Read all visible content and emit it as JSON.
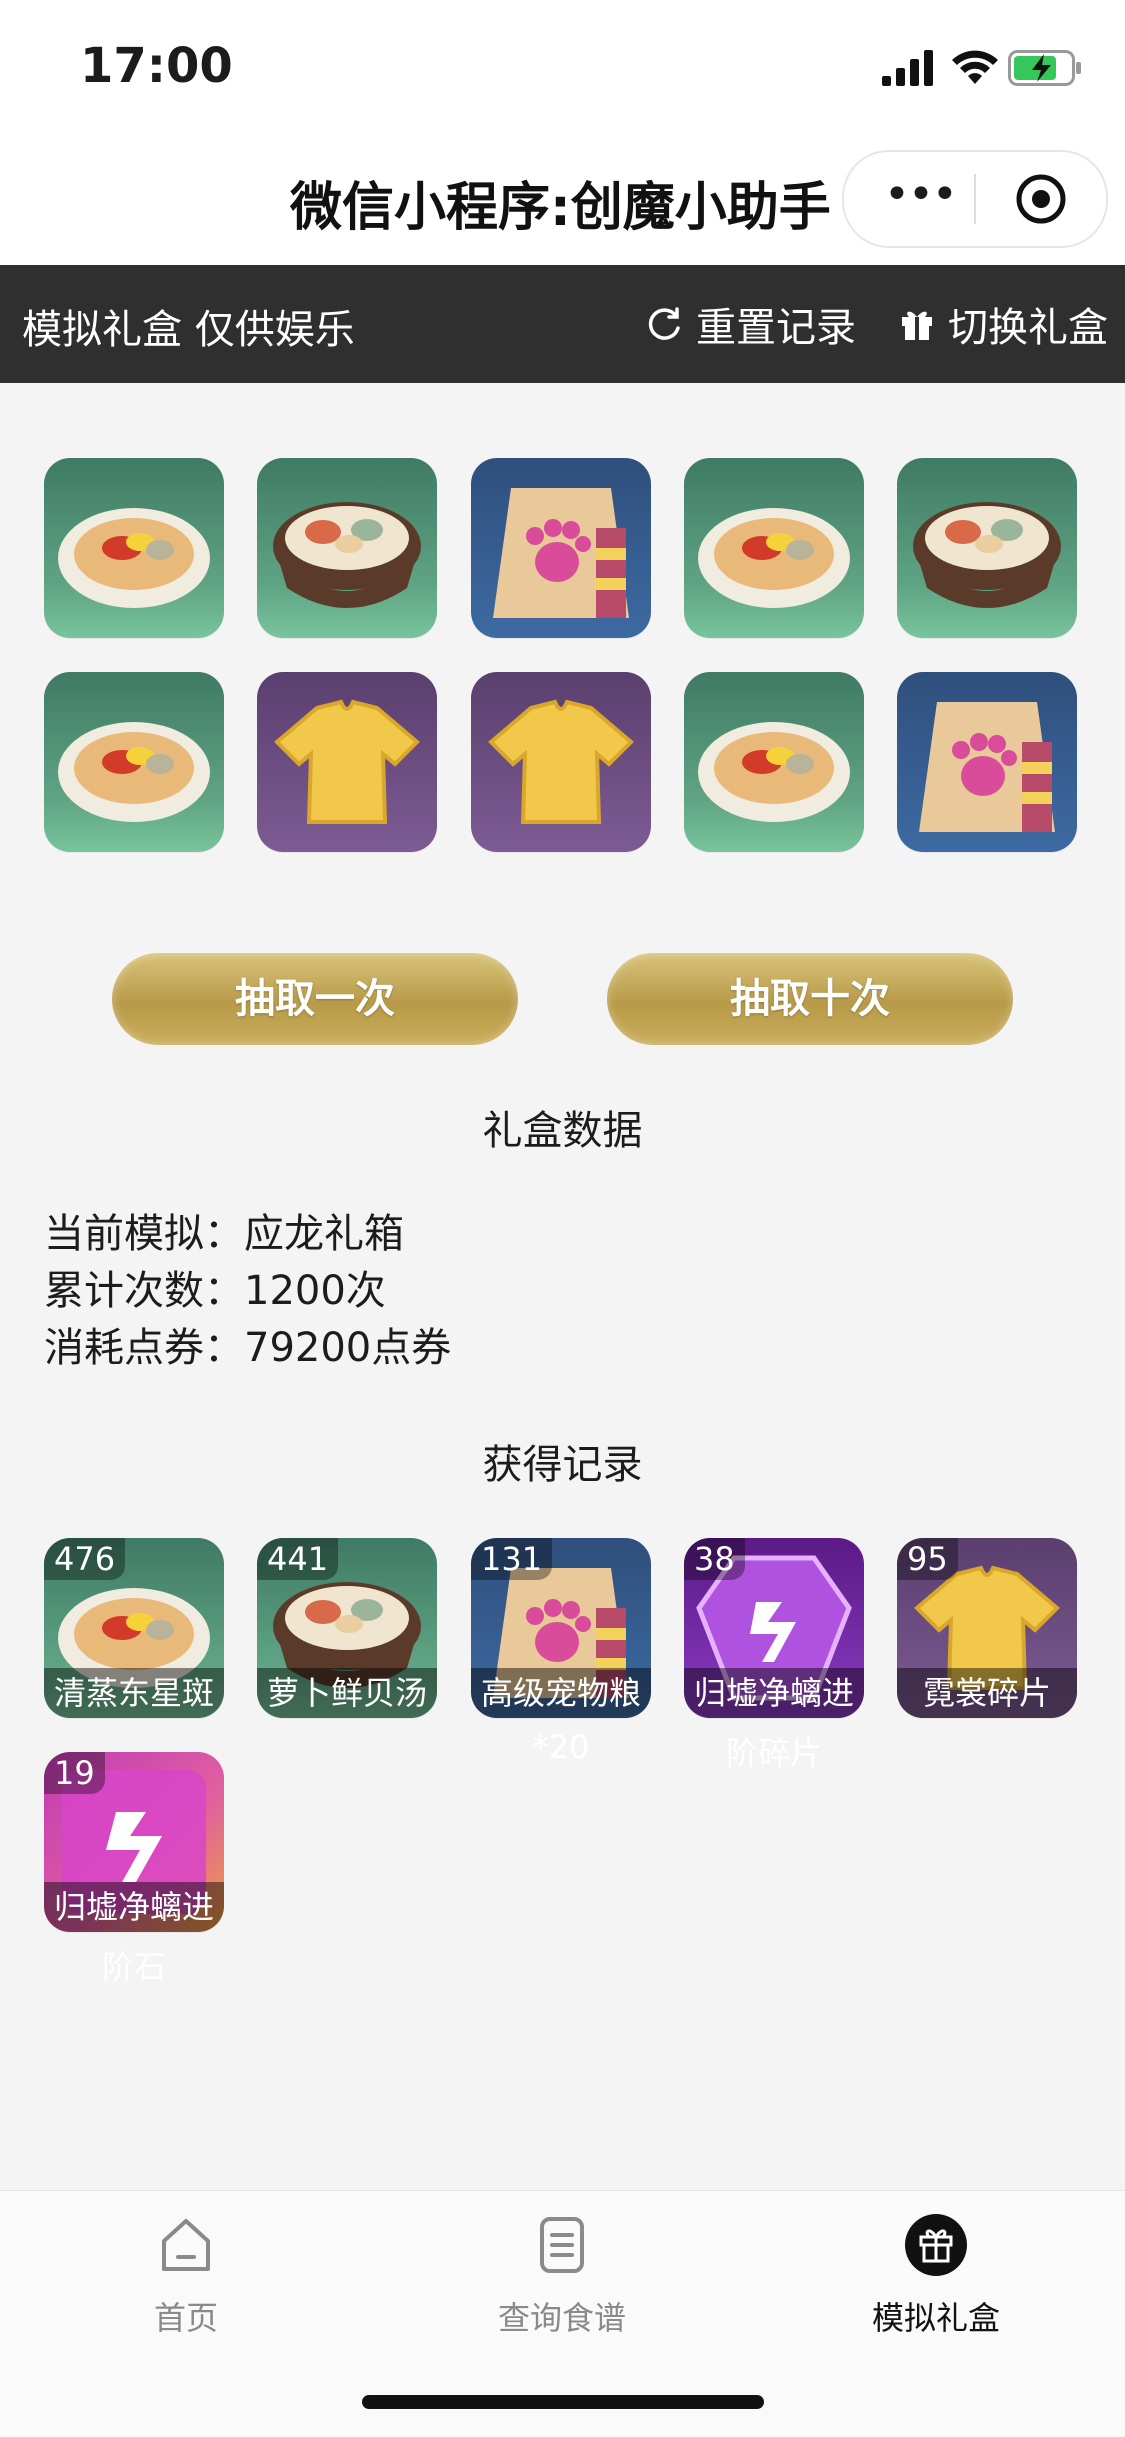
{
  "status_bar": {
    "time": "17:00"
  },
  "titlebar": {
    "title": "微信小程序:创魔小助手"
  },
  "topnav": {
    "left_label": "模拟礼盒 仅供娱乐",
    "reset_label": "重置记录",
    "switch_label": "切换礼盒"
  },
  "grid": {
    "items": [
      {
        "icon": "fish-dish-icon"
      },
      {
        "icon": "soup-bowl-icon"
      },
      {
        "icon": "pet-food-bag-icon"
      },
      {
        "icon": "fish-dish-icon"
      },
      {
        "icon": "soup-bowl-icon"
      },
      {
        "icon": "fish-dish-icon"
      },
      {
        "icon": "shirt-fragment-icon"
      },
      {
        "icon": "shirt-fragment-icon"
      },
      {
        "icon": "fish-dish-icon"
      },
      {
        "icon": "pet-food-bag-icon"
      }
    ]
  },
  "buttons": {
    "draw_once": "抽取一次",
    "draw_ten": "抽取十次"
  },
  "stats": {
    "section_title": "礼盒数据",
    "current_label": "当前模拟：",
    "current_value": "应龙礼箱",
    "count_label": "累计次数：",
    "count_value": "1200次",
    "cost_label": "消耗点券：",
    "cost_value": "79200点券"
  },
  "records": {
    "section_title": "获得记录",
    "items": [
      {
        "count": "476",
        "name": "清蒸东星斑",
        "overflow": "",
        "icon": "fish-dish-icon"
      },
      {
        "count": "441",
        "name": "萝卜鲜贝汤",
        "overflow": "",
        "icon": "soup-bowl-icon"
      },
      {
        "count": "131",
        "name": "高级宠物粮",
        "overflow": "*20",
        "icon": "pet-food-bag-icon"
      },
      {
        "count": "38",
        "name": "归墟净螭进",
        "overflow": "阶碎片",
        "icon": "crystal-fragment-icon"
      },
      {
        "count": "95",
        "name": "霓裳碎片",
        "overflow": "",
        "icon": "shirt-fragment-icon"
      },
      {
        "count": "19",
        "name": "归墟净螭进",
        "overflow": "阶石",
        "icon": "crystal-stone-icon"
      }
    ]
  },
  "tabbar": {
    "tabs": [
      {
        "label": "首页",
        "icon": "home-icon"
      },
      {
        "label": "查询食谱",
        "icon": "document-icon"
      },
      {
        "label": "模拟礼盒",
        "icon": "gift-icon"
      }
    ]
  }
}
